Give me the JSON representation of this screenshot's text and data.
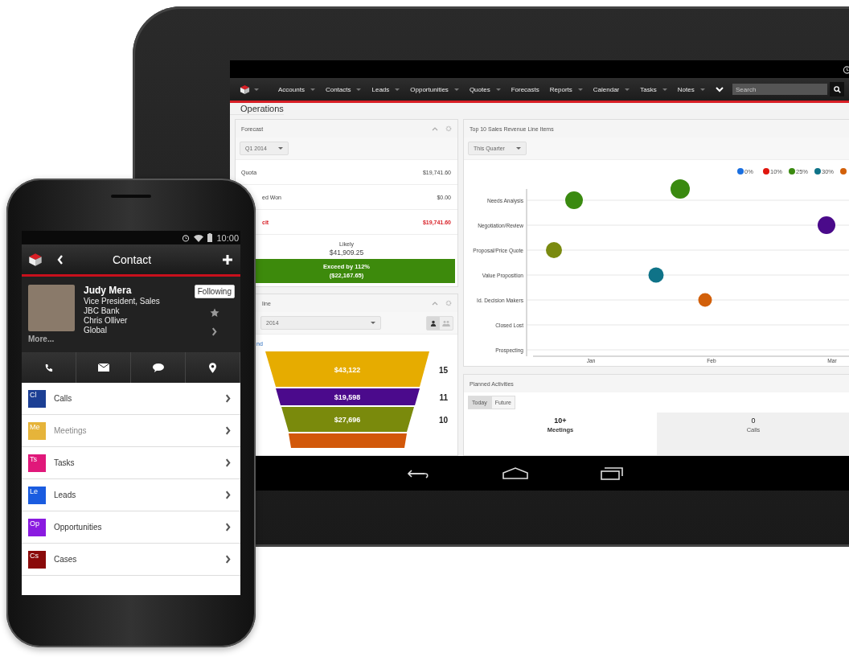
{
  "tablet": {
    "nav": {
      "items": [
        {
          "label": "Accounts",
          "dropdown": true
        },
        {
          "label": "Contacts",
          "dropdown": true
        },
        {
          "label": "Leads",
          "dropdown": true
        },
        {
          "label": "Opportunities",
          "dropdown": true
        },
        {
          "label": "Quotes",
          "dropdown": true
        },
        {
          "label": "Forecasts",
          "dropdown": false
        },
        {
          "label": "Reports",
          "dropdown": true
        },
        {
          "label": "Calendar",
          "dropdown": true
        },
        {
          "label": "Tasks",
          "dropdown": true
        },
        {
          "label": "Notes",
          "dropdown": true
        }
      ],
      "search": {
        "placeholder": "Search"
      }
    },
    "page_title": "Operations",
    "forecast": {
      "title": "Forecast",
      "period": "Q1 2014",
      "rows": [
        {
          "label": "Quota",
          "value": "$19,741.60",
          "kind": "normal"
        },
        {
          "label": "ed Won",
          "value": "$0.00",
          "kind": "normal"
        },
        {
          "label": "cit",
          "value": "$19,741.60",
          "kind": "deficit"
        }
      ],
      "likely_label": "Likely",
      "likely_value": "$41,909.25",
      "result_line1": "Exceed by 112%",
      "result_line2": "($22,167.65)"
    },
    "pipeline": {
      "title": "line",
      "period": "2014",
      "view_toggle": [
        {
          "kind": "user",
          "selected": true
        },
        {
          "kind": "group",
          "selected": false
        }
      ],
      "link": "nd",
      "funnel": [
        {
          "value": "$43,122",
          "count": "15",
          "color": "#e6ac00"
        },
        {
          "value": "$19,598",
          "count": "11",
          "color": "#4b0a8c"
        },
        {
          "value": "$27,696",
          "count": "10",
          "color": "#7a8a0c"
        },
        {
          "color": "#d2580a"
        }
      ]
    },
    "revenue_chart": {
      "title": "Top 10 Sales Revenue Line Items",
      "period": "This Quarter",
      "month_labels": [
        "Jan",
        "Feb",
        "Mar"
      ],
      "legend": [
        {
          "label": "0%",
          "color": "#1a6fe0"
        },
        {
          "label": "10%",
          "color": "#e0160e"
        },
        {
          "label": "25%",
          "color": "#3a8a10"
        },
        {
          "label": "30%",
          "color": "#0f7388"
        },
        {
          "color": "#d2600a"
        }
      ],
      "stage_labels": [
        "Needs Analysis",
        "Negotiation/Review",
        "Proposal/Price Quote",
        "Value Proposition",
        "Id. Decision Makers",
        "Closed Lost",
        "Prospecting"
      ]
    },
    "planned_activities": {
      "title": "Planned Activities",
      "tabs": [
        {
          "label": "Today",
          "selected": true
        },
        {
          "label": "Future",
          "selected": false
        }
      ],
      "stats": [
        {
          "value": "10+",
          "label": "Meetings",
          "selected": true
        },
        {
          "value": "0",
          "label": "Calls",
          "selected": false
        }
      ]
    }
  },
  "phone": {
    "status_bar": {
      "time": "10:00"
    },
    "header": {
      "title": "Contact"
    },
    "contact": {
      "name": "Judy Mera",
      "lines": [
        "Vice President, Sales",
        "JBC Bank",
        "Chris Olliver",
        "Global"
      ],
      "more": "More...",
      "follow_button": "Following"
    },
    "actions": [
      {
        "kind": "call"
      },
      {
        "kind": "email"
      },
      {
        "kind": "message"
      },
      {
        "kind": "location"
      }
    ],
    "modules": [
      {
        "abbr": "Cl",
        "label": "Calls",
        "color": "#1c3f94",
        "disabled": false
      },
      {
        "abbr": "Me",
        "label": "Meetings",
        "color": "#e6b43a",
        "disabled": true
      },
      {
        "abbr": "Ts",
        "label": "Tasks",
        "color": "#e0187a",
        "disabled": false
      },
      {
        "abbr": "Le",
        "label": "Leads",
        "color": "#1a5ce0",
        "disabled": false
      },
      {
        "abbr": "Op",
        "label": "Opportunities",
        "color": "#8a1ae0",
        "disabled": false
      },
      {
        "abbr": "Cs",
        "label": "Cases",
        "color": "#8a0a0a",
        "disabled": false
      }
    ]
  }
}
